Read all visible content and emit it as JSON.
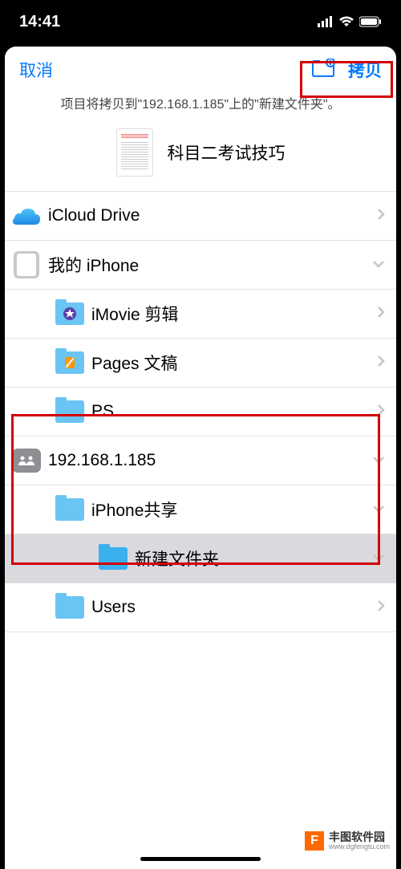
{
  "status": {
    "time": "14:41"
  },
  "nav": {
    "cancel": "取消",
    "copy": "拷贝"
  },
  "subtitle": "项目将拷贝到\"192.168.1.185\"上的\"新建文件夹\"。",
  "doc_title": "科目二考试技巧",
  "rows": {
    "icloud": "iCloud Drive",
    "iphone": "我的 iPhone",
    "imovie": "iMovie 剪辑",
    "pages": "Pages 文稿",
    "ps": "PS",
    "server": "192.168.1.185",
    "share": "iPhone共享",
    "newfolder": "新建文件夹",
    "users": "Users"
  },
  "watermark": {
    "label": "丰图软件园",
    "url": "www.dgfengtu.com",
    "logo": "F"
  }
}
